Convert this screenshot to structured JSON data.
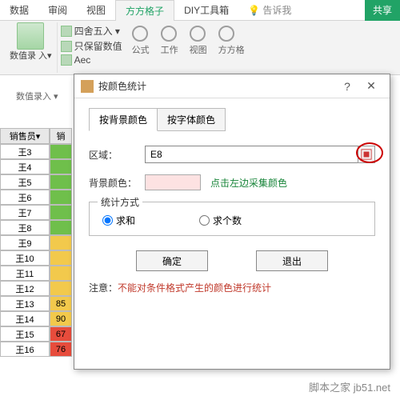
{
  "ribbon": {
    "tabs": [
      "数据",
      "审阅",
      "视图",
      "方方格子",
      "DIY工具箱"
    ],
    "active": 3,
    "tellme": "告诉我",
    "share": "共享",
    "group_label": "数值录\n入▾",
    "sublabel": "数值录入 ▾",
    "items": [
      "四舍五入 ▾",
      "只保留数值",
      "Aec"
    ],
    "circle_labels": [
      "公式",
      "工作",
      "视图",
      "方方格"
    ]
  },
  "sheet": {
    "header": [
      "销售员▾",
      "销"
    ],
    "rows": [
      {
        "d": "王3",
        "e": "",
        "bg": "#6fbf4b"
      },
      {
        "d": "王4",
        "e": "",
        "bg": "#6fbf4b"
      },
      {
        "d": "王5",
        "e": "",
        "bg": "#6fbf4b"
      },
      {
        "d": "王6",
        "e": "",
        "bg": "#6fbf4b"
      },
      {
        "d": "王7",
        "e": "",
        "bg": "#6fbf4b"
      },
      {
        "d": "王8",
        "e": "",
        "bg": "#6fbf4b"
      },
      {
        "d": "王9",
        "e": "",
        "bg": "#f2c94c"
      },
      {
        "d": "王10",
        "e": "",
        "bg": "#f2c94c"
      },
      {
        "d": "王11",
        "e": "",
        "bg": "#f2c94c"
      },
      {
        "d": "王12",
        "e": "",
        "bg": "#f2c94c"
      },
      {
        "d": "王13",
        "e": "85",
        "bg": "#f2c94c"
      },
      {
        "d": "王14",
        "e": "90",
        "bg": "#f2c94c"
      },
      {
        "d": "王15",
        "e": "67",
        "bg": "#e74c3c"
      },
      {
        "d": "王16",
        "e": "76",
        "bg": "#e74c3c"
      }
    ]
  },
  "dialog": {
    "title": "按颜色统计",
    "tabs": [
      "按背景颜色",
      "按字体颜色"
    ],
    "range_label": "区域：",
    "range_value": "E8",
    "bg_label": "背景颜色：",
    "bg_hint": "点击左边采集颜色",
    "method_label": "统计方式",
    "method_sum": "求和",
    "method_count": "求个数",
    "method_selected": "sum",
    "ok": "确定",
    "cancel": "退出",
    "note_prefix": "注意：",
    "note_text": "不能对条件格式产生的颜色进行统计"
  },
  "watermark": "脚本之家 jb51.net"
}
